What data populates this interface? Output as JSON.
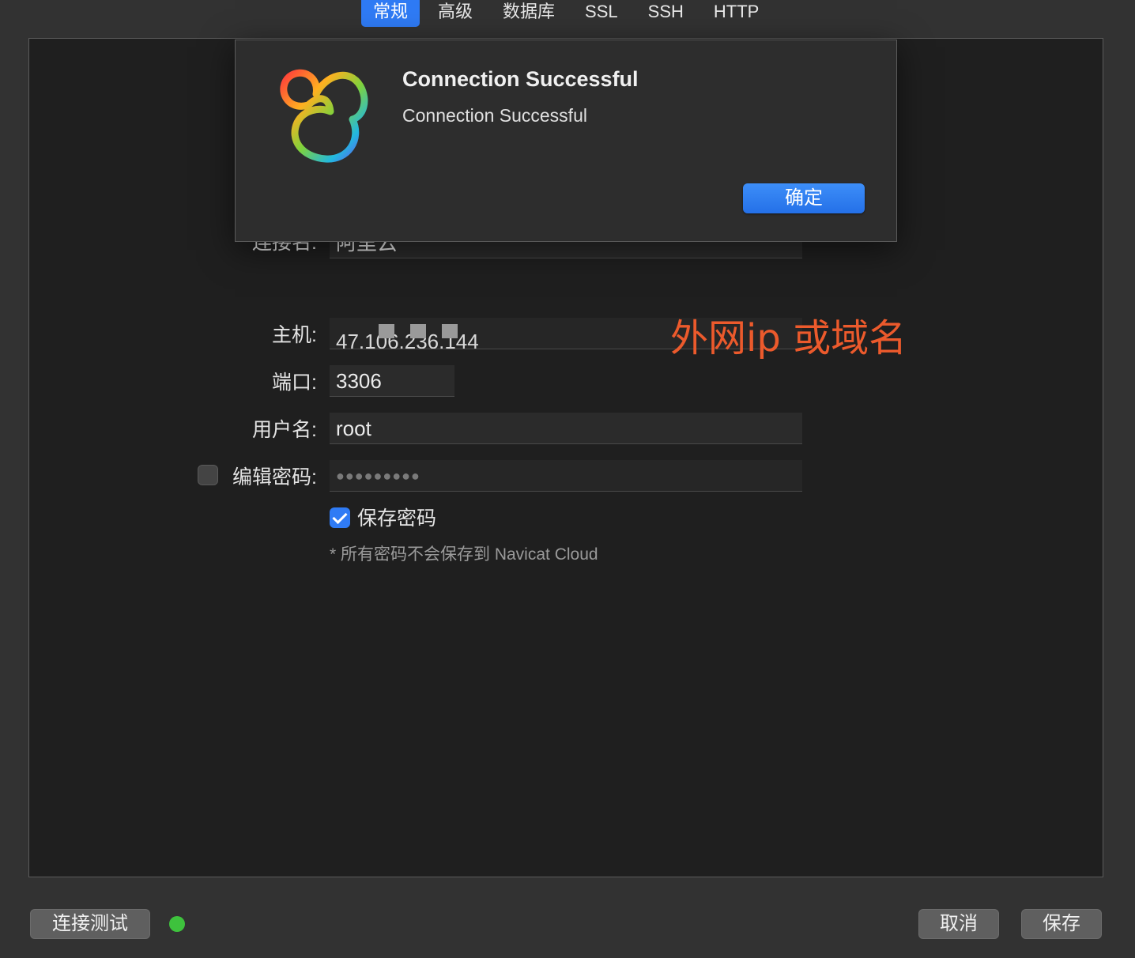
{
  "tabs": [
    {
      "label": "常规",
      "active": true
    },
    {
      "label": "高级",
      "active": false
    },
    {
      "label": "数据库",
      "active": false
    },
    {
      "label": "SSL",
      "active": false
    },
    {
      "label": "SSH",
      "active": false
    },
    {
      "label": "HTTP",
      "active": false
    }
  ],
  "form": {
    "connection_name_label": "连接名:",
    "connection_name_value": "阿里云",
    "host_label": "主机:",
    "host_value": "47.106.236.144",
    "port_label": "端口:",
    "port_value": "3306",
    "username_label": "用户名:",
    "username_value": "root",
    "edit_password_label": "编辑密码:",
    "edit_password_checked": false,
    "password_mask": "●●●●●●●●●",
    "save_password_label": "保存密码",
    "save_password_checked": true,
    "cloud_note": "* 所有密码不会保存到 Navicat Cloud"
  },
  "annotation": {
    "text": "外网ip 或域名",
    "color": "#ec5a2c"
  },
  "dialog": {
    "title": "Connection Successful",
    "message": "Connection Successful",
    "ok_label": "确定",
    "logo_icon": "navicat-logo-icon"
  },
  "footer": {
    "test_connection_label": "连接测试",
    "status": "success",
    "status_color": "#3ec23d",
    "cancel_label": "取消",
    "save_label": "保存"
  },
  "colors": {
    "accent": "#2f7bf5",
    "panel": "#1f1f1f",
    "window": "#323232"
  }
}
